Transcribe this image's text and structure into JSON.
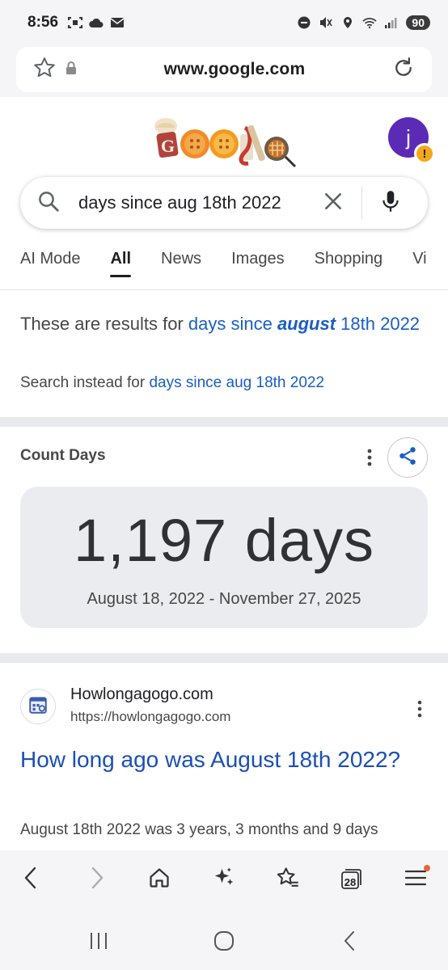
{
  "status_bar": {
    "time": "8:56",
    "battery": "90",
    "icons": [
      "screenshot-icon",
      "cloud-icon",
      "mail-icon",
      "dnd-icon",
      "mute-icon",
      "location-icon",
      "wifi-icon",
      "signal-icon"
    ]
  },
  "browser": {
    "url": "www.google.com",
    "icons": [
      "bookmark-star-icon",
      "lock-icon",
      "reload-icon"
    ]
  },
  "account": {
    "initial": "j",
    "warning_symbol": "!"
  },
  "search": {
    "query": "days since aug 18th 2022"
  },
  "tabs": [
    {
      "label": "AI Mode",
      "active": false
    },
    {
      "label": "All",
      "active": true
    },
    {
      "label": "News",
      "active": false
    },
    {
      "label": "Images",
      "active": false
    },
    {
      "label": "Shopping",
      "active": false
    },
    {
      "label": "Vi",
      "active": false
    }
  ],
  "correction": {
    "prefix": "These are results for ",
    "link_part1": "days since ",
    "link_emphasis": "august",
    "link_part2": " 18th 2022",
    "instead_prefix": "Search instead for ",
    "instead_link": "days since aug 18th 2022"
  },
  "count_days": {
    "title": "Count Days",
    "value": "1,197 days",
    "range": "August 18, 2022 - November 27, 2025"
  },
  "result": {
    "site_name": "Howlongagogo.com",
    "site_url": "https://howlongagogo.com",
    "title": "How long ago was August 18th 2022?",
    "snippet": "August 18th 2022 was 3 years, 3 months and 9 days"
  },
  "toolbar": {
    "tab_count": "28"
  },
  "colors": {
    "link_blue": "#1a5ec4",
    "title_blue": "#1a4fb8",
    "avatar_purple": "#5b2bb5",
    "warning_amber": "#f2a81d",
    "menu_badge": "#e8663d"
  }
}
